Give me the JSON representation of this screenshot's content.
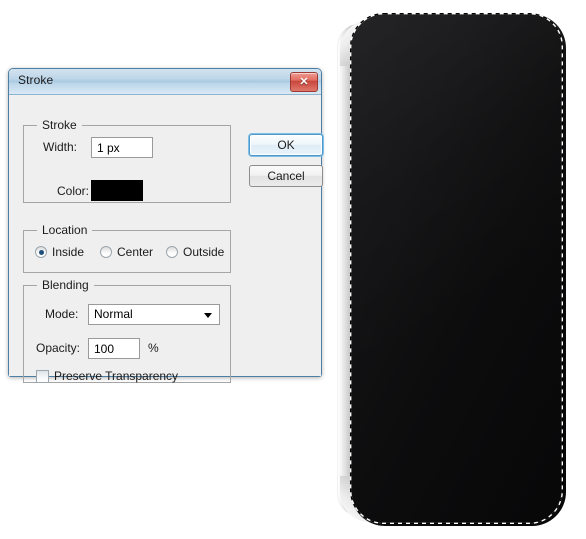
{
  "dialog": {
    "title": "Stroke",
    "close_icon": "close-icon",
    "close_glyph": "✕",
    "buttons": {
      "ok": "OK",
      "cancel": "Cancel"
    },
    "groups": {
      "stroke": {
        "legend": "Stroke",
        "width_label": "Width:",
        "width_value": "1 px",
        "width_placeholder": "1 px",
        "color_label": "Color:",
        "color_value": "#000000"
      },
      "location": {
        "legend": "Location",
        "options": [
          {
            "label": "Inside",
            "selected": true
          },
          {
            "label": "Center",
            "selected": false
          },
          {
            "label": "Outside",
            "selected": false
          }
        ]
      },
      "blending": {
        "legend": "Blending",
        "mode_label": "Mode:",
        "mode_value": "Normal",
        "opacity_label": "Opacity:",
        "opacity_value": "100",
        "opacity_placeholder": "100",
        "opacity_unit": "%",
        "preserve_transparency_label": "Preserve Transparency",
        "preserve_transparency_checked": false
      }
    }
  },
  "canvas": {
    "device": {
      "name": "black-rounded-device",
      "body_color": "#0d0d0e",
      "edge_color": "#c9c9c9",
      "selection": "marching-ants-dashed-outline"
    }
  }
}
